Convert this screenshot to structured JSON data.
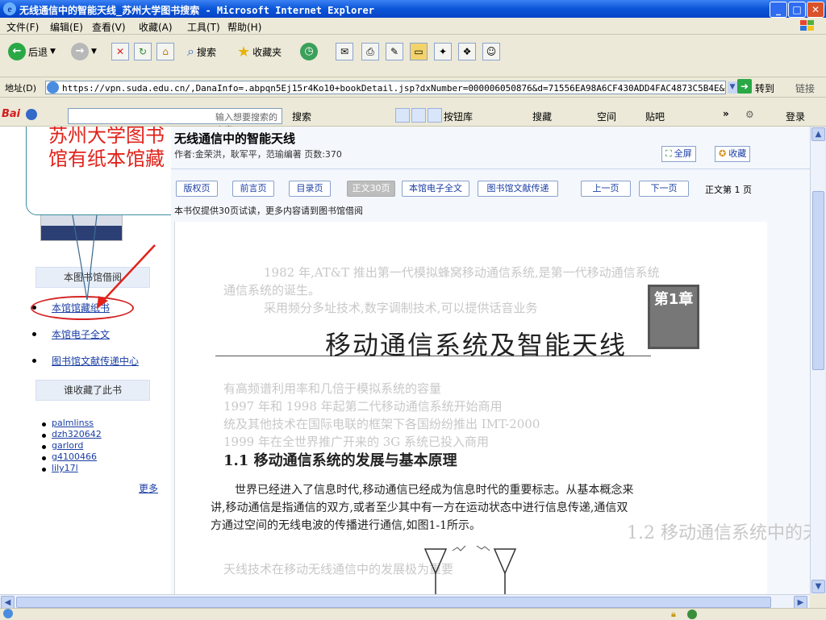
{
  "window": {
    "title": "无线通信中的智能天线_苏州大学图书搜索 - Microsoft Internet Explorer"
  },
  "menu": [
    "文件(F)",
    "编辑(E)",
    "查看(V)",
    "收藏(A)",
    "工具(T)",
    "帮助(H)"
  ],
  "toolbar": {
    "back": "后退",
    "search": "搜索",
    "favorites": "收藏夹"
  },
  "address": {
    "label": "地址(D)",
    "url": "https://vpn.suda.edu.cn/,DanaInfo=.abpqn5Ej15r4Ko10+bookDetail.jsp?dxNumber=000006050876&d=71556EA98A6CF430ADD4FAC4873C5B4E&fen",
    "go": "转到",
    "links": "链接"
  },
  "baidu": {
    "logo": "Bai",
    "placeholder": "输入想要搜索的内容",
    "search": "搜索",
    "button_lib": "按钮库",
    "favorites": "搜藏",
    "space": "空间",
    "tieba": "贴吧",
    "login": "登录"
  },
  "callout": "苏州大学图书馆有纸本馆藏",
  "book": {
    "title": "无线通信中的智能天线",
    "meta": "作者:金荣洪，耿军平，范瑜编著  页数:370",
    "fullscreen": "全屏",
    "collect": "收藏",
    "notice": "本书仅提供30页试读，更多内容请到图书馆借阅",
    "page_info": "正文第 1 页"
  },
  "page_buttons": [
    {
      "label": "版权页",
      "active": false
    },
    {
      "label": "前言页",
      "active": false
    },
    {
      "label": "目录页",
      "active": false
    },
    {
      "label": "正文30页",
      "active": true
    },
    {
      "label": "本馆电子全文",
      "active": false
    },
    {
      "label": "图书馆文献传递",
      "active": false
    },
    {
      "label": "上一页",
      "active": false
    },
    {
      "label": "下一页",
      "active": false
    }
  ],
  "sidebar": {
    "borrow_header": "本图书馆借阅",
    "links": [
      "本馆馆藏纸书",
      "本馆电子全文",
      "图书馆文献传递中心"
    ],
    "collected_header": "谁收藏了此书",
    "users": [
      "palmlinss",
      "dzh320642",
      "garlord",
      "g4100466",
      "lily17l"
    ],
    "more": "更多"
  },
  "page_text": {
    "chapter_label": "第1章",
    "chapter_title": "移动通信系统及智能天线",
    "section": "1.1   移动通信系统的发展与基本原理",
    "para1": "世界已经进入了信息时代,移动通信已经成为信息时代的重要标志。从基本概念来",
    "para2": "讲,移动通信是指通信的双方,或者至少其中有一方在运动状态中进行信息传递,通信双",
    "para3": "方通过空间的无线电波的传播进行通信,如图1-1所示。"
  },
  "colors": {
    "accent": "#1a3ea5",
    "callout_text": "#e0231b",
    "titlebar": "#0a55d8"
  }
}
